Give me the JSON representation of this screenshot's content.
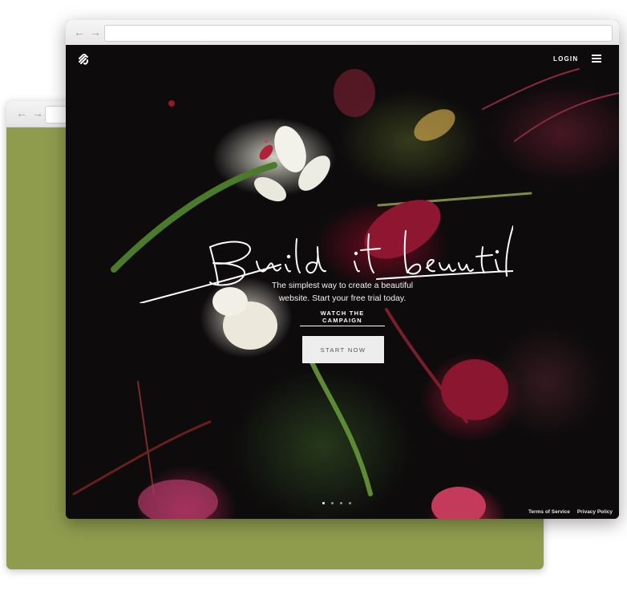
{
  "header": {
    "login_label": "LOGIN"
  },
  "hero": {
    "headline": "Build it beautiful",
    "subtitle_line1": "The simplest way to create a beautiful",
    "subtitle_line2": "website. Start your free trial today.",
    "watch_label": "WATCH THE CAMPAIGN",
    "cta_label": "START NOW",
    "slide_count": 4,
    "active_slide": 1
  },
  "footer": {
    "terms_label": "Terms of Service",
    "privacy_label": "Privacy Policy"
  },
  "icons": {
    "back": "arrow-left-icon",
    "forward": "arrow-right-icon",
    "logo": "squarespace-logo-icon",
    "menu": "hamburger-menu-icon"
  },
  "colors": {
    "back_window": "#8f9c4e",
    "hero_background": "#0d0b0c",
    "cta_background": "#ededed"
  }
}
